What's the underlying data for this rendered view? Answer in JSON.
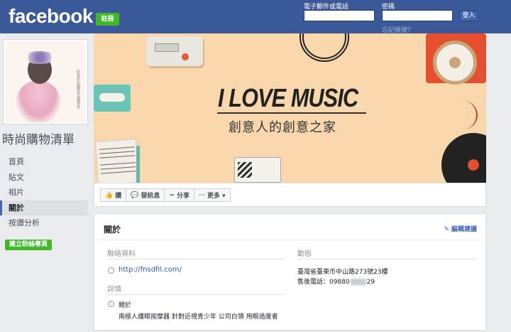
{
  "header": {
    "logo": "facebook",
    "signup_label": "註冊",
    "email_label": "電子郵件或電話",
    "email_value": "",
    "password_label": "密碼",
    "password_value": "",
    "login_label": "登入",
    "forgot_label": "忘記帳號？"
  },
  "page": {
    "name": "時尚購物清單",
    "nav": [
      {
        "label": "首頁",
        "active": false
      },
      {
        "label": "貼文",
        "active": false
      },
      {
        "label": "相片",
        "active": false
      },
      {
        "label": "關於",
        "active": true
      },
      {
        "label": "按讚分析",
        "active": false
      }
    ],
    "create_page_label": "建立粉絲專頁",
    "profile_caption": "好看的衣服都在這裡等你"
  },
  "cover": {
    "title": "I LOVE MUSIC",
    "subtitle": "創意人的創意之家"
  },
  "actions": [
    {
      "icon": "thumbs-up-icon",
      "glyph": "👍",
      "label": "讚"
    },
    {
      "icon": "message-icon",
      "glyph": "💬",
      "label": "發訊息"
    },
    {
      "icon": "share-icon",
      "glyph": "➦",
      "label": "分享"
    },
    {
      "icon": "more-icon",
      "glyph": "⋯",
      "label": "更多 ▾"
    }
  ],
  "about": {
    "title": "關於",
    "edit_label": "編輯建議",
    "contact_heading": "聯絡資料",
    "website": "http://fnsdfil.com/",
    "details_heading": "詳情",
    "about_label": "關於",
    "about_text": "南極人護眼按摩器 針對近視青少年 公司白領 用眼過度者",
    "status_heading": "動態",
    "address": "臺灣省臺東市中山路273號23樓",
    "phone_prefix": "售後電話：09880",
    "phone_suffix": "29"
  },
  "colors": {
    "brand_blue": "#3b5998",
    "green": "#42b72a",
    "link": "#365899"
  }
}
